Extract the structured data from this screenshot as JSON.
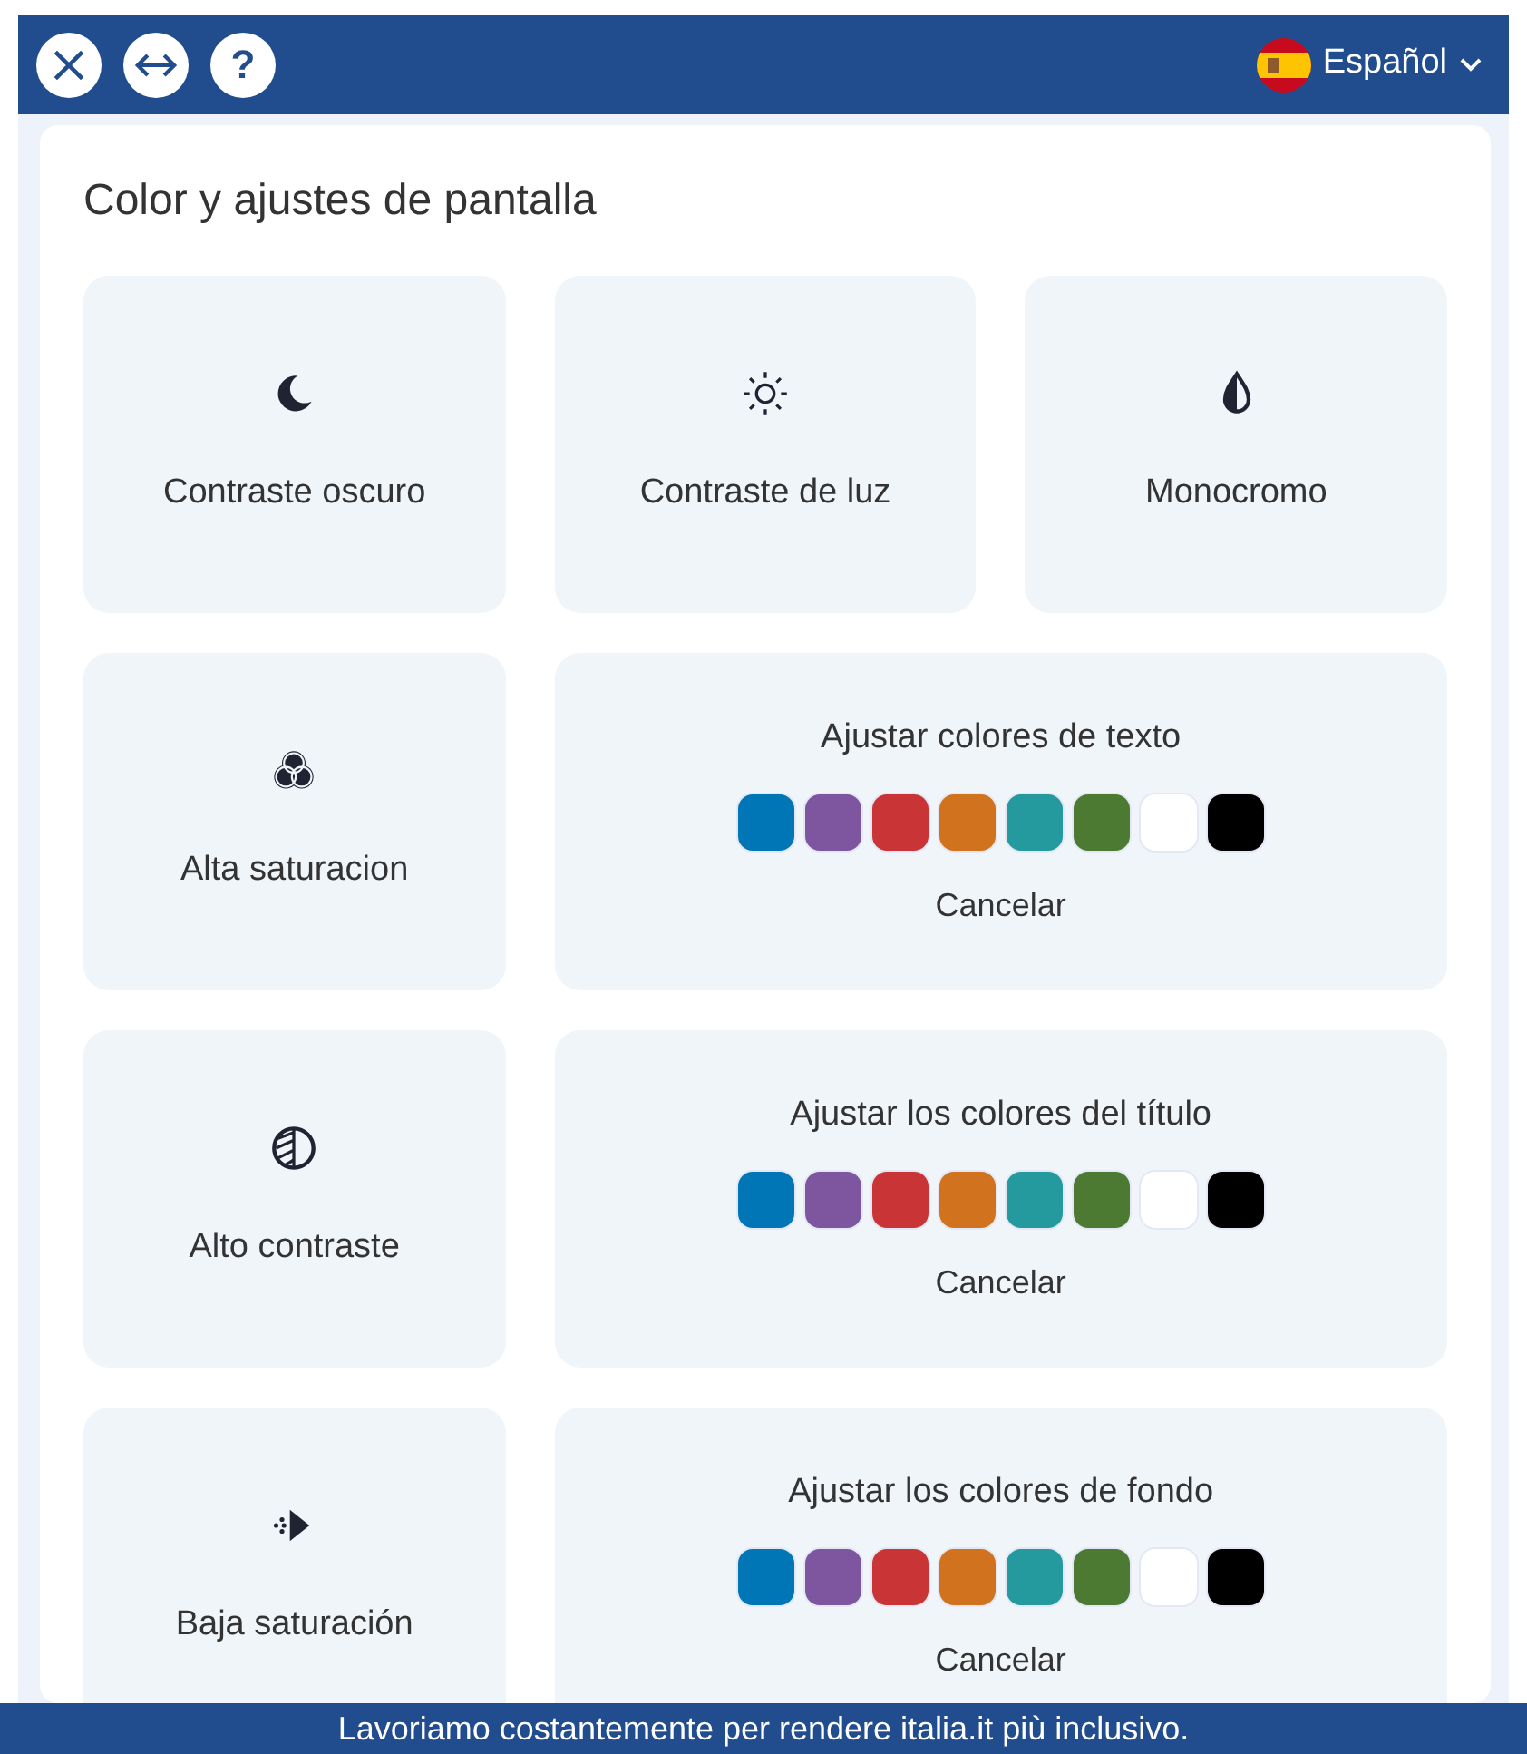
{
  "toolbar": {
    "buttons": [
      {
        "kind": "close"
      },
      {
        "kind": "resize"
      },
      {
        "kind": "help",
        "label": "?"
      }
    ],
    "language": {
      "label": "Español"
    }
  },
  "section": {
    "title": "Color y ajustes de pantalla"
  },
  "tiles": [
    {
      "kind": "toggle",
      "label": "Contraste oscuro"
    },
    {
      "kind": "toggle",
      "label": "Contraste de luz"
    },
    {
      "kind": "toggle",
      "label": "Monocromo"
    },
    {
      "kind": "toggle",
      "label": "Alta saturacion"
    },
    {
      "kind": "colors",
      "title": "Ajustar colores de texto",
      "swatches": [
        {
          "color": "#0076b6"
        },
        {
          "color": "#7e56a0"
        },
        {
          "color": "#c93537"
        },
        {
          "color": "#d1721f"
        },
        {
          "color": "#249a9e"
        },
        {
          "color": "#4c7a32"
        },
        {
          "color": "#ffffff"
        },
        {
          "color": "#000000"
        }
      ],
      "cancel": "Cancelar"
    },
    {
      "kind": "toggle",
      "label": "Alto contraste"
    },
    {
      "kind": "colors",
      "title": "Ajustar los colores del título",
      "swatches": [
        {
          "color": "#0076b6"
        },
        {
          "color": "#7e56a0"
        },
        {
          "color": "#c93537"
        },
        {
          "color": "#d1721f"
        },
        {
          "color": "#249a9e"
        },
        {
          "color": "#4c7a32"
        },
        {
          "color": "#ffffff"
        },
        {
          "color": "#000000"
        }
      ],
      "cancel": "Cancelar"
    },
    {
      "kind": "toggle",
      "label": "Baja saturación"
    },
    {
      "kind": "colors",
      "title": "Ajustar los colores de fondo",
      "swatches": [
        {
          "color": "#0076b6"
        },
        {
          "color": "#7e56a0"
        },
        {
          "color": "#c93537"
        },
        {
          "color": "#d1721f"
        },
        {
          "color": "#249a9e"
        },
        {
          "color": "#4c7a32"
        },
        {
          "color": "#ffffff"
        },
        {
          "color": "#000000"
        }
      ],
      "cancel": "Cancelar"
    }
  ],
  "banner": {
    "text": "Lavoriamo costantemente per rendere italia.it più inclusivo."
  }
}
